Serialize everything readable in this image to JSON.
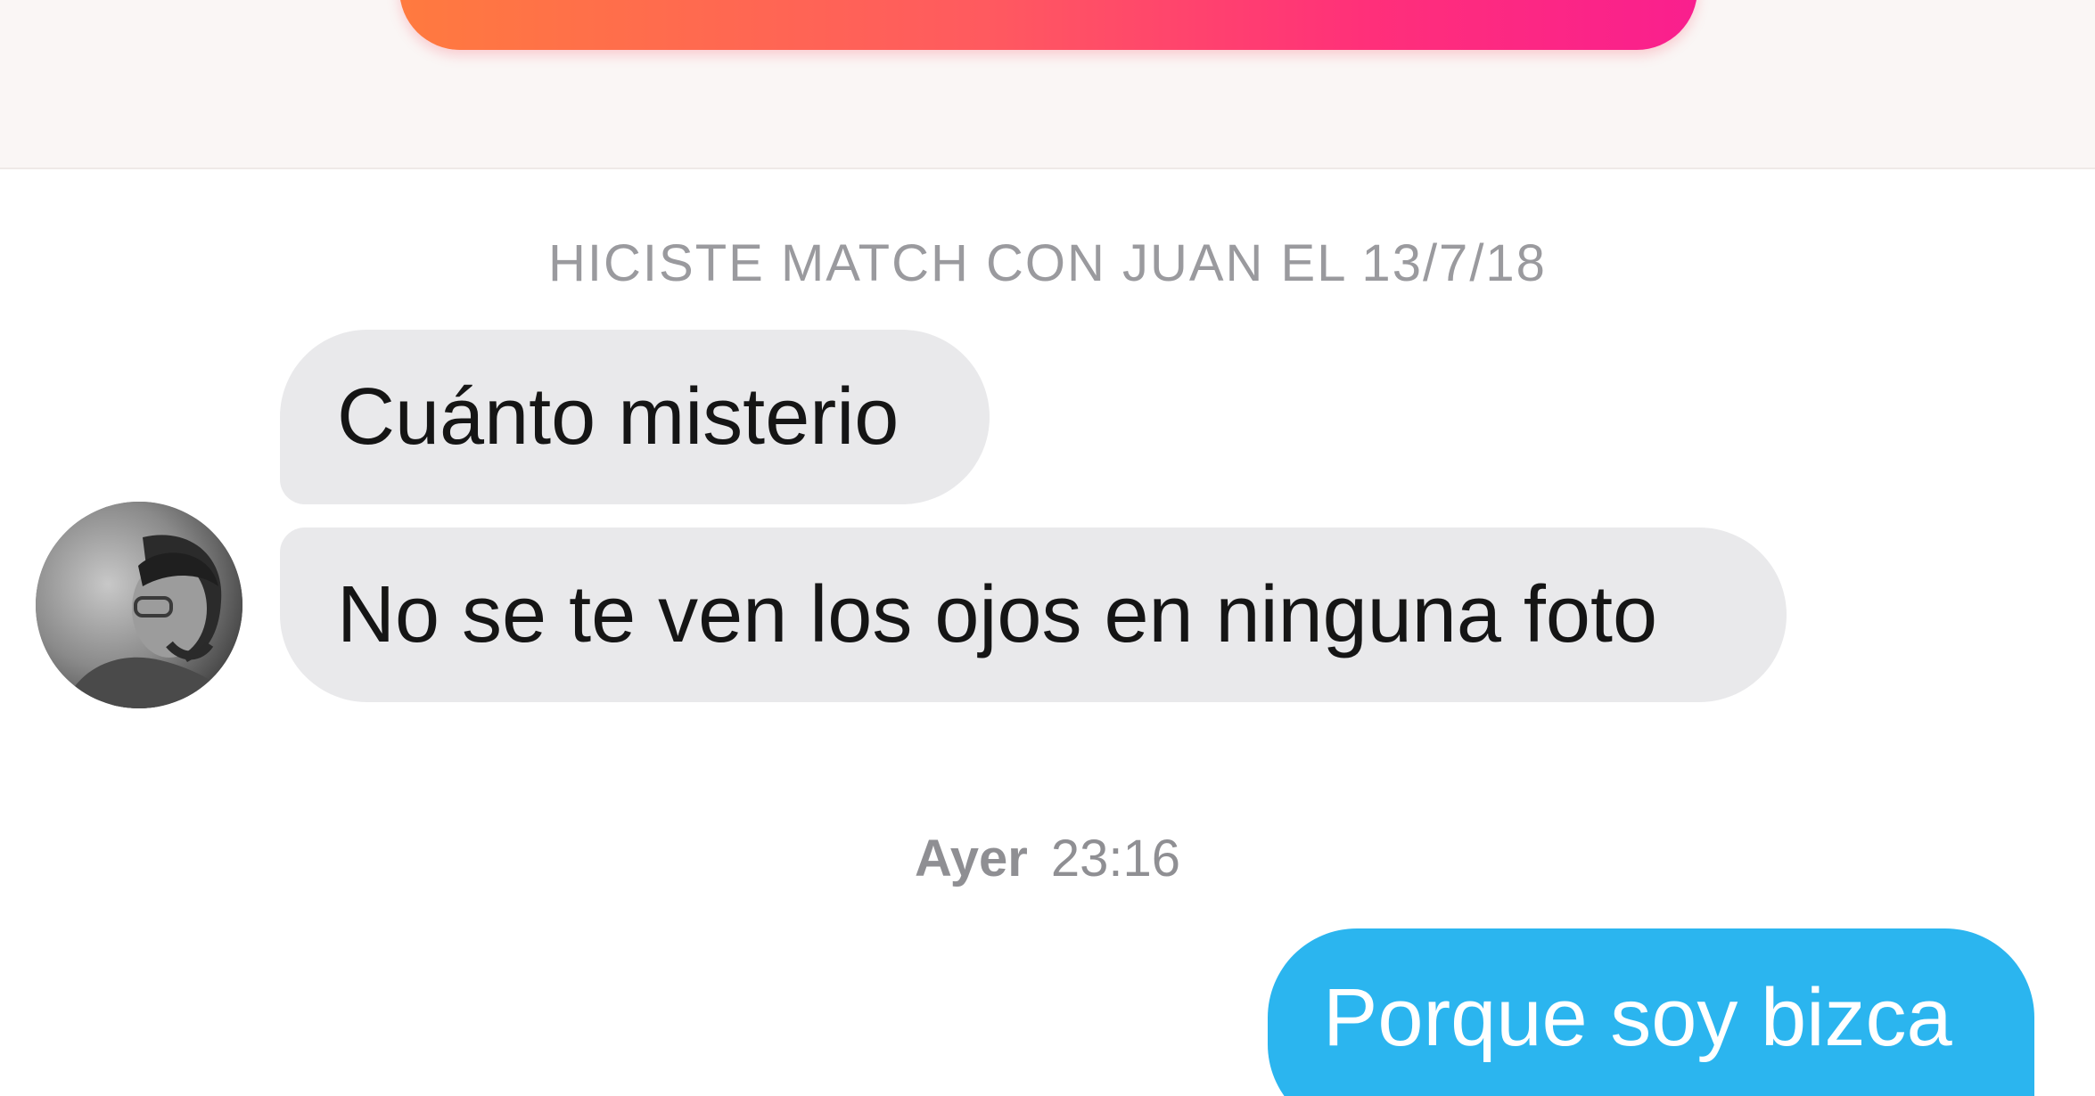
{
  "match_notice": "HICISTE MATCH CON JUAN EL 13/7/18",
  "avatar_icon": "profile-photo",
  "messages_received": [
    {
      "text": "Cuánto misterio"
    },
    {
      "text": "No se te ven los ojos en ninguna foto"
    }
  ],
  "timestamp": {
    "day": "Ayer",
    "time": "23:16"
  },
  "messages_sent": [
    {
      "text": "Porque soy bizca"
    }
  ],
  "colors": {
    "sent_bubble": "#2bb5ef",
    "received_bubble": "#e9e9eb",
    "cta_gradient_start": "#ff7a3f",
    "cta_gradient_end": "#f91f8e"
  }
}
